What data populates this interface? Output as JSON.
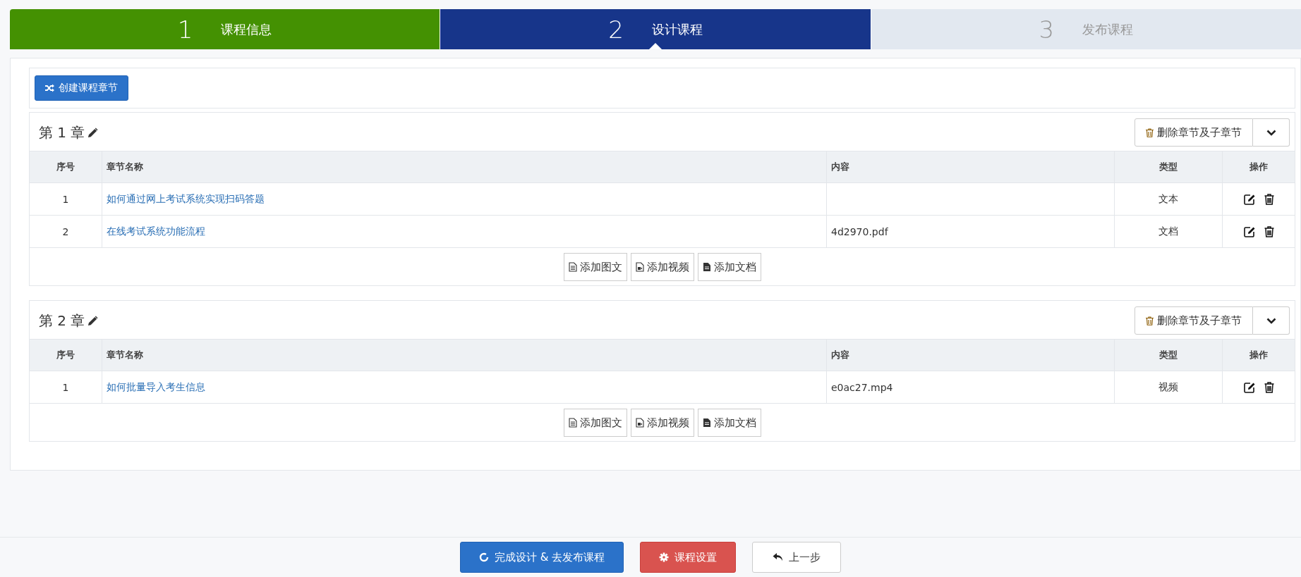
{
  "steps": [
    {
      "number": "1",
      "label": "课程信息",
      "kind": "done"
    },
    {
      "number": "2",
      "label": "设计课程",
      "kind": "current"
    },
    {
      "number": "3",
      "label": "发布课程",
      "kind": "todo"
    }
  ],
  "create_button": "创建课程章节",
  "chapters": [
    {
      "title": "第 1 章",
      "delete_button": "删除章节及子章节",
      "columns": [
        "序号",
        "章节名称",
        "内容",
        "类型",
        "操作"
      ],
      "rows": [
        {
          "index": "1",
          "name": "如何通过网上考试系统实现扫码答题",
          "content": "",
          "type": "文本"
        },
        {
          "index": "2",
          "name": "在线考试系统功能流程",
          "content": "4d2970.pdf",
          "type": "文档"
        }
      ],
      "add_buttons": [
        {
          "kind": "text",
          "label": "添加图文"
        },
        {
          "kind": "video",
          "label": "添加视频"
        },
        {
          "kind": "doc",
          "label": "添加文档"
        }
      ]
    },
    {
      "title": "第 2 章",
      "delete_button": "删除章节及子章节",
      "columns": [
        "序号",
        "章节名称",
        "内容",
        "类型",
        "操作"
      ],
      "rows": [
        {
          "index": "1",
          "name": "如何批量导入考生信息",
          "content": "e0ac27.mp4",
          "type": "视频"
        }
      ],
      "add_buttons": [
        {
          "kind": "text",
          "label": "添加图文"
        },
        {
          "kind": "video",
          "label": "添加视频"
        },
        {
          "kind": "doc",
          "label": "添加文档"
        }
      ]
    }
  ],
  "footer_buttons": [
    {
      "kind": "primary",
      "label": "完成设计 & 去发布课程"
    },
    {
      "kind": "danger",
      "label": "课程设置"
    },
    {
      "kind": "back",
      "label": "上一步"
    }
  ]
}
